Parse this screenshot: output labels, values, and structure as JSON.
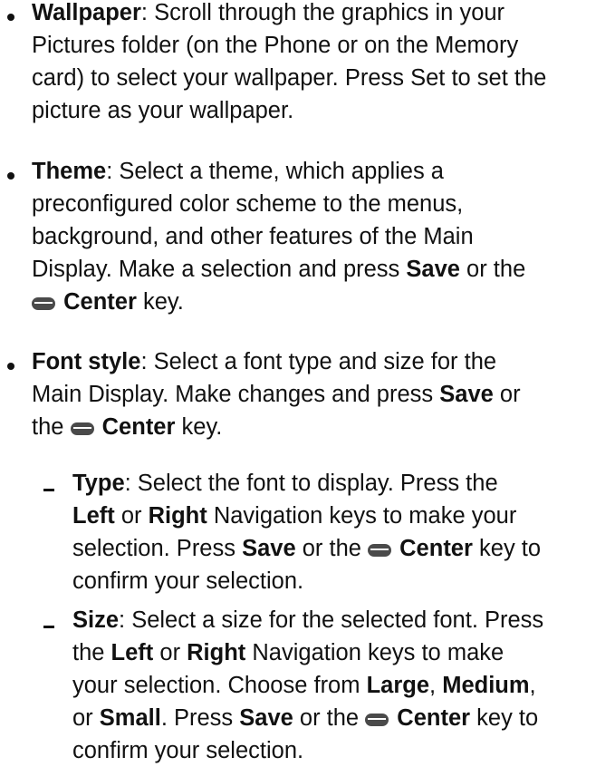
{
  "items": {
    "wallpaper": {
      "term": "Wallpaper",
      "line1": ": Scroll through the graphics in your",
      "line2": "Pictures folder (on the Phone or on the Memory",
      "line3": "card) to select your wallpaper. Press Set to set the",
      "line4": "picture as your wallpaper."
    },
    "theme": {
      "term": "Theme",
      "line1": ": Select a theme, which applies a",
      "line2": "preconfigured color scheme to the menus,",
      "line3": "background, and other features of the Main",
      "line4a": "Display. Make a selection and press ",
      "line4b": "Save",
      "line4c": " or the",
      "line5a": "Center",
      "line5b": " key."
    },
    "font_style": {
      "term": "Font style",
      "line1": ": Select a font type and size for the",
      "line2a": "Main Display. Make changes and press ",
      "line2b": "Save",
      "line2c": " or",
      "line3a": "the ",
      "line3b": "Center",
      "line3c": " key."
    },
    "type": {
      "term": "Type",
      "line1": ": Select the font to display. Press the",
      "line2a": "Left",
      "line2b": " or ",
      "line2c": "Right",
      "line2d": " Navigation keys to make your",
      "line3a": "selection. Press ",
      "line3b": "Save",
      "line3c": " or the ",
      "line3d": "Center",
      "line3e": " key to",
      "line4": "confirm your selection."
    },
    "size": {
      "term": "Size",
      "line1": ": Select a size for the selected font. Press",
      "line2a": "the ",
      "line2b": "Left",
      "line2c": " or ",
      "line2d": "Right",
      "line2e": " Navigation keys to make",
      "line3a": "your selection. Choose from ",
      "line3b": "Large",
      "line3c": ", ",
      "line3d": "Medium",
      "line3e": ",",
      "line4a": "or ",
      "line4b": "Small",
      "line4c": ". Press ",
      "line4d": "Save",
      "line4e": " or the ",
      "line4f": "Center",
      "line4g": " key to",
      "line5": "confirm your selection."
    }
  },
  "icons": {
    "key": "center-key-icon"
  }
}
